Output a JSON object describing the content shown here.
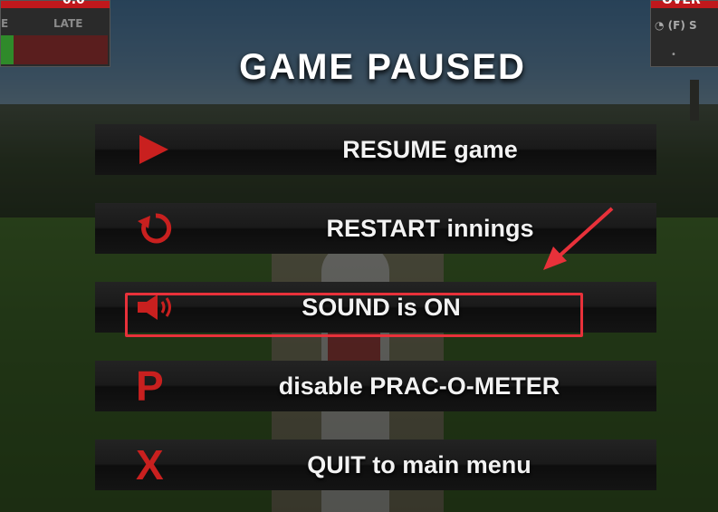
{
  "hud": {
    "left": {
      "score": "0.0",
      "label": "LATE",
      "prev": "E"
    },
    "right": {
      "title": "OVER",
      "row": "◔ (F) S",
      "dot": "•"
    }
  },
  "menu": {
    "title": "GAME PAUSED",
    "buttons": [
      {
        "id": "resume",
        "label": "RESUME game",
        "icon": "play-icon"
      },
      {
        "id": "restart",
        "label": "RESTART innings",
        "icon": "restart-icon"
      },
      {
        "id": "sound",
        "label": "SOUND is ON",
        "icon": "speaker-icon"
      },
      {
        "id": "prac",
        "label": "disable PRAC-O-METER",
        "icon": "p-letter-icon",
        "icon_text": "P"
      },
      {
        "id": "quit",
        "label": "QUIT to main menu",
        "icon": "x-letter-icon",
        "icon_text": "X"
      }
    ]
  },
  "colors": {
    "accent_red": "#c9201f",
    "annotation_red": "#e8313a",
    "button_text": "#f2f2f2"
  },
  "annotation": {
    "highlighted_item": "sound",
    "arrow_color": "#e8313a"
  }
}
